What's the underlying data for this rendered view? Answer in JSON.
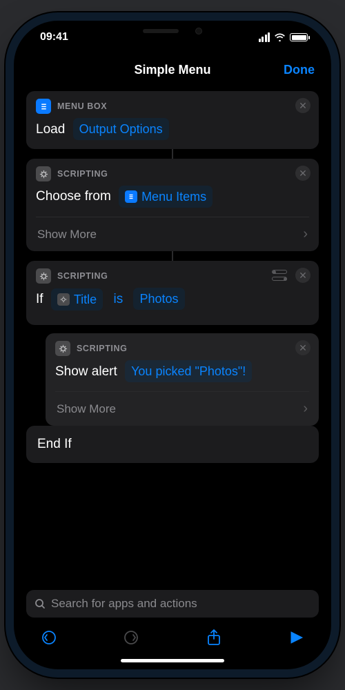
{
  "status": {
    "time": "09:41"
  },
  "nav": {
    "title": "Simple Menu",
    "done": "Done"
  },
  "actions": {
    "load": {
      "appLabel": "MENU BOX",
      "word1": "Load",
      "token": "Output Options"
    },
    "choose": {
      "appLabel": "SCRIPTING",
      "word1": "Choose from",
      "token": "Menu Items",
      "showMore": "Show More"
    },
    "if": {
      "appLabel": "SCRIPTING",
      "word1": "If",
      "token1": "Title",
      "word2": "is",
      "token2": "Photos"
    },
    "alert": {
      "appLabel": "SCRIPTING",
      "word1": "Show alert",
      "token": "You picked \"Photos\"!",
      "showMore": "Show More"
    },
    "endif": "End If"
  },
  "search": {
    "placeholder": "Search for apps and actions"
  }
}
